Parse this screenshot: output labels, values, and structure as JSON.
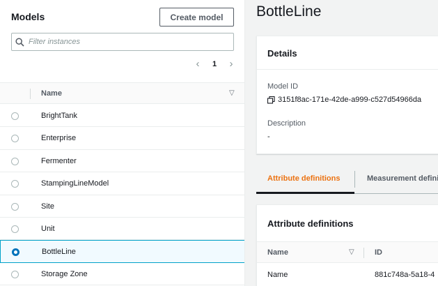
{
  "models_panel": {
    "title": "Models",
    "create_button": "Create model",
    "filter_placeholder": "Filter instances",
    "pagination": {
      "current_page": "1",
      "prev_icon": "chevron-left-icon",
      "next_icon": "chevron-right-icon"
    },
    "table": {
      "column_name": "Name",
      "sort_icon": "sort-down-icon",
      "rows": [
        {
          "name": "BrightTank",
          "selected": false
        },
        {
          "name": "Enterprise",
          "selected": false
        },
        {
          "name": "Fermenter",
          "selected": false
        },
        {
          "name": "StampingLineModel",
          "selected": false
        },
        {
          "name": "Site",
          "selected": false
        },
        {
          "name": "Unit",
          "selected": false
        },
        {
          "name": "BottleLine",
          "selected": true
        },
        {
          "name": "Storage Zone",
          "selected": false
        }
      ]
    }
  },
  "detail": {
    "title": "BottleLine",
    "details_card": {
      "title": "Details",
      "model_id_label": "Model ID",
      "model_id_value": "3151f8ac-171e-42de-a999-c527d54966da",
      "copy_icon": "copy-icon",
      "description_label": "Description",
      "description_value": "-"
    },
    "tabs": [
      {
        "label": "Attribute definitions",
        "active": true
      },
      {
        "label": "Measurement definitions",
        "active": false
      }
    ],
    "attributes_card": {
      "title": "Attribute definitions",
      "columns": [
        "Name",
        "ID"
      ],
      "rows": [
        {
          "name": "Name",
          "id": "881c748a-5a18-4"
        }
      ]
    }
  },
  "colors": {
    "accent_orange": "#ec7211",
    "selection_blue": "#0073bb",
    "selection_border": "#00a1c9",
    "background": "#f2f3f3"
  }
}
